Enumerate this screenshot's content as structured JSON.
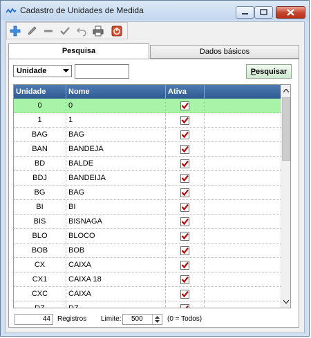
{
  "window": {
    "title": "Cadastro de Unidades de Medida"
  },
  "toolbar": {
    "buttons": [
      {
        "name": "add",
        "icon": "plus-icon"
      },
      {
        "name": "edit",
        "icon": "pencil-icon"
      },
      {
        "name": "delete",
        "icon": "minus-icon"
      },
      {
        "name": "confirm",
        "icon": "check-icon"
      },
      {
        "name": "undo",
        "icon": "undo-icon"
      },
      {
        "name": "print",
        "icon": "printer-icon"
      },
      {
        "name": "exit",
        "icon": "power-icon"
      }
    ]
  },
  "tabs": [
    {
      "label": "Pesquisa",
      "active": true
    },
    {
      "label": "Dados básicos",
      "active": false
    }
  ],
  "search": {
    "field_value": "Unidade",
    "query": "",
    "button_label": "Pesquisar",
    "button_underline": "P",
    "button_rest": "esquisar"
  },
  "grid": {
    "columns": [
      "Unidade",
      "Nome",
      "Ativa",
      ""
    ],
    "rows": [
      {
        "unidade": "0",
        "nome": "0",
        "ativa": true,
        "selected": true
      },
      {
        "unidade": "1",
        "nome": "1",
        "ativa": true
      },
      {
        "unidade": "BAG",
        "nome": "BAG",
        "ativa": true
      },
      {
        "unidade": "BAN",
        "nome": "BANDEJA",
        "ativa": true
      },
      {
        "unidade": "BD",
        "nome": "BALDE",
        "ativa": true
      },
      {
        "unidade": "BDJ",
        "nome": "BANDEIJA",
        "ativa": true
      },
      {
        "unidade": "BG",
        "nome": "BAG",
        "ativa": true
      },
      {
        "unidade": "BI",
        "nome": "BI",
        "ativa": true
      },
      {
        "unidade": "BIS",
        "nome": "BISNAGA",
        "ativa": true
      },
      {
        "unidade": "BLO",
        "nome": "BLOCO",
        "ativa": true
      },
      {
        "unidade": "BOB",
        "nome": "BOB",
        "ativa": true
      },
      {
        "unidade": "CX",
        "nome": "CAIXA",
        "ativa": true
      },
      {
        "unidade": "CX1",
        "nome": "CAIXA 18",
        "ativa": true
      },
      {
        "unidade": "CXC",
        "nome": "CAIXA",
        "ativa": true
      },
      {
        "unidade": "DZ",
        "nome": "DZ",
        "ativa": true
      }
    ]
  },
  "footer": {
    "count": "44",
    "count_label": "Registros",
    "limit_label": "Limite:",
    "limit_value": "500",
    "limit_hint": "(0 = Todos)"
  },
  "colors": {
    "header": "#2e5a93",
    "selected_row": "#a7f3a7",
    "check": "#c00000"
  }
}
